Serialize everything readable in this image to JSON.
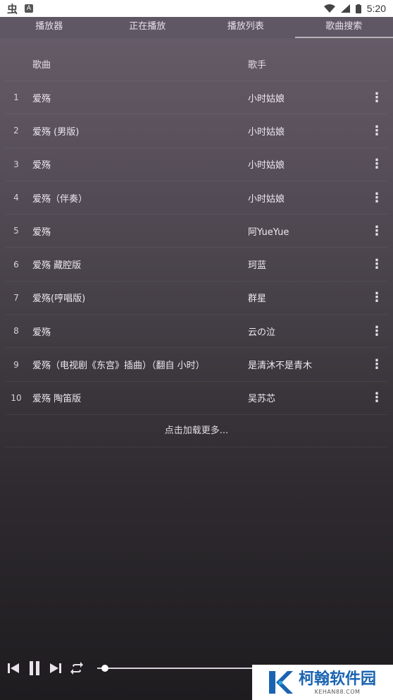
{
  "status_bar": {
    "time": "5:20",
    "icons": [
      "app-icon",
      "a-notification-icon",
      "wifi-icon",
      "signal-icon",
      "battery-icon"
    ]
  },
  "tabs": [
    {
      "label": "播放器",
      "active": false
    },
    {
      "label": "正在播放",
      "active": false
    },
    {
      "label": "播放列表",
      "active": false
    },
    {
      "label": "歌曲搜索",
      "active": true
    }
  ],
  "list": {
    "header": {
      "title": "歌曲",
      "artist": "歌手"
    },
    "rows": [
      {
        "num": "1",
        "title": "爱殇",
        "artist": "小时姑娘"
      },
      {
        "num": "2",
        "title": "爱殇 (男版)",
        "artist": "小时姑娘"
      },
      {
        "num": "3",
        "title": "爱殇",
        "artist": "小时姑娘"
      },
      {
        "num": "4",
        "title": "爱殇（伴奏）",
        "artist": "小时姑娘"
      },
      {
        "num": "5",
        "title": "爱殇",
        "artist": "阿YueYue"
      },
      {
        "num": "6",
        "title": "爱殇 藏腔版",
        "artist": "珂蓝"
      },
      {
        "num": "7",
        "title": "爱殇(哼唱版)",
        "artist": "群星"
      },
      {
        "num": "8",
        "title": "爱殇",
        "artist": "云の泣"
      },
      {
        "num": "9",
        "title": "爱殇（电视剧《东宫》插曲）（翻自 小时）",
        "artist": "是清沐不是青木"
      },
      {
        "num": "10",
        "title": "爱殇 陶笛版",
        "artist": "吴苏芯"
      }
    ],
    "more_icon": "⋮",
    "load_more": "点击加载更多..."
  },
  "player": {
    "progress": 0.05,
    "controls": [
      "skip-previous-icon",
      "pause-icon",
      "skip-next-icon",
      "repeat-icon"
    ]
  },
  "watermark": {
    "name": "柯翰软件园",
    "url": "KEHAN88.COM"
  },
  "colors": {
    "background_top": "#6a5f6c",
    "background_bottom": "#1e1c1f",
    "tab_bar": "#605765",
    "watermark_blue": "#1a63b0"
  }
}
